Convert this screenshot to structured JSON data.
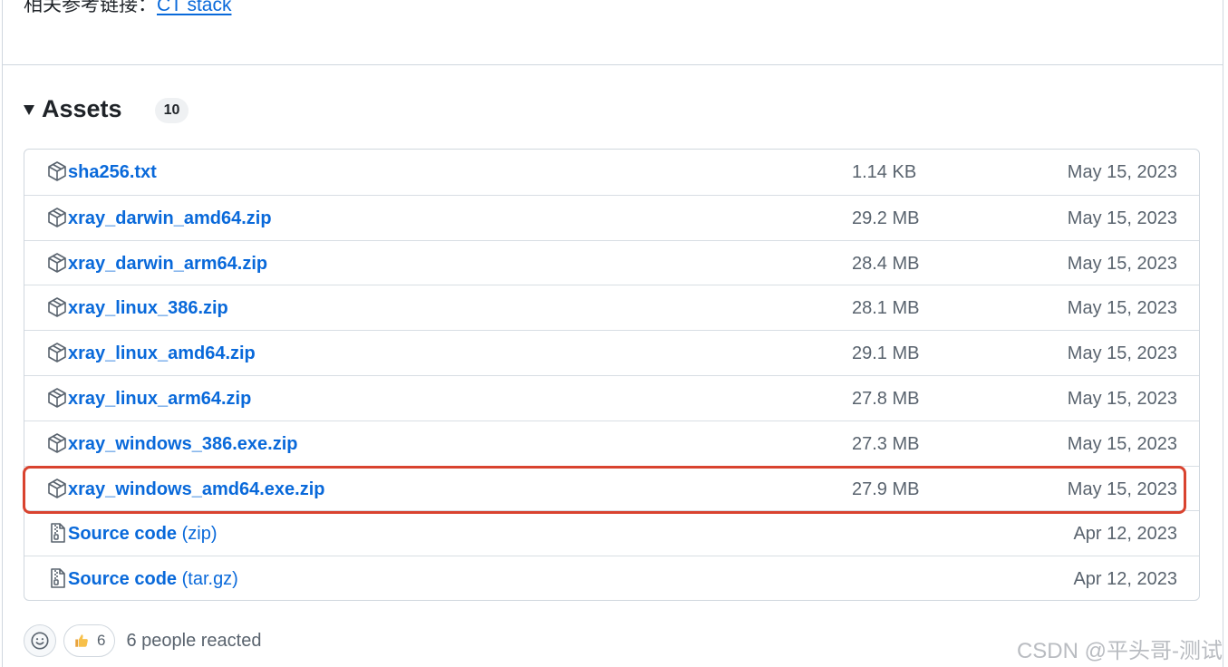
{
  "reference": {
    "prefix": "相关参考链接：",
    "link_text": "CT stack"
  },
  "assets": {
    "title": "Assets",
    "count": "10",
    "items": [
      {
        "name": "sha256.txt",
        "suffix": "",
        "size": "1.14 KB",
        "date": "May 15, 2023",
        "icon": "package-icon"
      },
      {
        "name": "xray_darwin_amd64.zip",
        "suffix": "",
        "size": "29.2 MB",
        "date": "May 15, 2023",
        "icon": "package-icon"
      },
      {
        "name": "xray_darwin_arm64.zip",
        "suffix": "",
        "size": "28.4 MB",
        "date": "May 15, 2023",
        "icon": "package-icon"
      },
      {
        "name": "xray_linux_386.zip",
        "suffix": "",
        "size": "28.1 MB",
        "date": "May 15, 2023",
        "icon": "package-icon"
      },
      {
        "name": "xray_linux_amd64.zip",
        "suffix": "",
        "size": "29.1 MB",
        "date": "May 15, 2023",
        "icon": "package-icon"
      },
      {
        "name": "xray_linux_arm64.zip",
        "suffix": "",
        "size": "27.8 MB",
        "date": "May 15, 2023",
        "icon": "package-icon"
      },
      {
        "name": "xray_windows_386.exe.zip",
        "suffix": "",
        "size": "27.3 MB",
        "date": "May 15, 2023",
        "icon": "package-icon"
      },
      {
        "name": "xray_windows_amd64.exe.zip",
        "suffix": "",
        "size": "27.9 MB",
        "date": "May 15, 2023",
        "icon": "package-icon",
        "highlighted": true
      },
      {
        "name": "Source code",
        "suffix": "(zip)",
        "size": "",
        "date": "Apr 12, 2023",
        "icon": "file-zip-icon"
      },
      {
        "name": "Source code",
        "suffix": "(tar.gz)",
        "size": "",
        "date": "Apr 12, 2023",
        "icon": "file-zip-icon"
      }
    ]
  },
  "reactions": {
    "thumbs_count": "6",
    "summary": "6 people reacted"
  },
  "watermark": "CSDN @平头哥-测试",
  "colors": {
    "link": "#0969da",
    "highlight_border": "#d9432f",
    "muted_text": "#59636e"
  }
}
